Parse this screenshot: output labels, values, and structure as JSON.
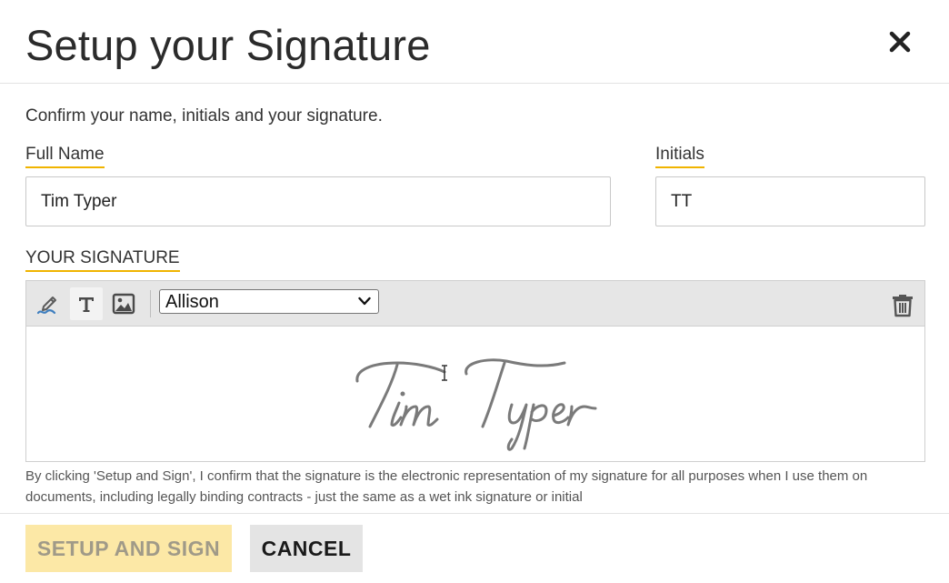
{
  "dialog": {
    "title": "Setup your Signature",
    "intro": "Confirm your name, initials and your signature.",
    "accent_color": "#f0b400"
  },
  "full_name": {
    "label": "Full Name",
    "value": "Tim Typer"
  },
  "initials": {
    "label": "Initials",
    "value": "TT"
  },
  "signature": {
    "label": "YOUR SIGNATURE",
    "modes": [
      {
        "name": "draw",
        "icon": "pen-icon"
      },
      {
        "name": "type",
        "icon": "type-text-icon",
        "active": true
      },
      {
        "name": "upload",
        "icon": "image-icon"
      }
    ],
    "font": "Allison",
    "signature_text": "Tim Typer",
    "signature_color": "#777777"
  },
  "disclaimer": "By clicking 'Setup and Sign', I confirm that the signature is the electronic representation of my signature for all purposes when I use them on documents, including legally binding contracts - just the same as a wet ink signature or initial",
  "buttons": {
    "primary": "SETUP AND SIGN",
    "cancel": "CANCEL"
  }
}
